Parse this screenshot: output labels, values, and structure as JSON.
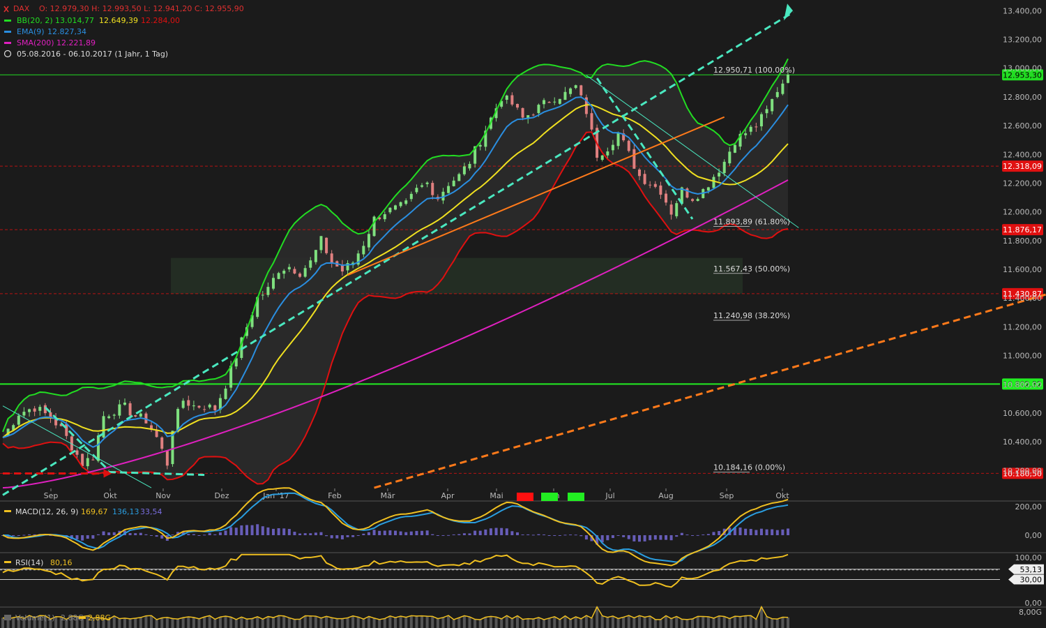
{
  "header": {
    "symbol": "DAX",
    "ohlc": "O: 12.979,30  H: 12.993,50  L: 12.941,20  C: 12.955,90",
    "bb_label": "BB(20, 2)",
    "bb_upper": "13.014,77",
    "bb_mid": "12.649,39",
    "bb_lower": "12.284,00",
    "ema_label": "EMA(9)",
    "ema_value": "12.827,34",
    "sma_label": "SMA(200)",
    "sma_value": "12.221,89",
    "range": "05.08.2016 - 06.10.2017  (1 Jahr, 1 Tag)"
  },
  "colors": {
    "background": "#1b1b1b",
    "bb_band": "#22dd22",
    "bb_mid": "#f0e020",
    "bb_lower": "#e01010",
    "ema": "#2a8ee0",
    "sma": "#e020c0",
    "trend_cyan": "#4ae8c0",
    "trend_orange": "#ff7a1a",
    "support_green": "#22ee22",
    "level_red": "#e01010",
    "macd": "#f0c020",
    "signal": "#2a9ee0",
    "hist": "#7a6ee0"
  },
  "chart_data": [
    {
      "type": "line",
      "title": "DAX",
      "x_ticks": [
        "Sep",
        "Okt",
        "Nov",
        "Dez",
        "Jan '17",
        "Feb",
        "Mär",
        "Apr",
        "Mai",
        "Jun",
        "Jul",
        "Aug",
        "Sep",
        "Okt"
      ],
      "y_ticks": [
        "13.400,00",
        "13.200,00",
        "13.000,00",
        "12.800,00",
        "12.600,00",
        "12.400,00",
        "12.200,00",
        "12.000,00",
        "11.800,00",
        "11.600,00",
        "11.400,00",
        "11.200,00",
        "11.000,00",
        "10.800,00",
        "10.600,00",
        "10.400,00",
        "10.200,00"
      ],
      "ylim": [
        10100,
        13450
      ],
      "price_series": [
        [
          0,
          10430
        ],
        [
          3,
          10600
        ],
        [
          6,
          10640
        ],
        [
          9,
          10570
        ],
        [
          11,
          10490
        ],
        [
          13,
          10370
        ],
        [
          15,
          10250
        ],
        [
          17,
          10300
        ],
        [
          19,
          10580
        ],
        [
          21,
          10620
        ],
        [
          23,
          10640
        ],
        [
          25,
          10580
        ],
        [
          27,
          10550
        ],
        [
          29,
          10430
        ],
        [
          31,
          10250
        ],
        [
          32,
          10500
        ],
        [
          34,
          10690
        ],
        [
          36,
          10650
        ],
        [
          38,
          10650
        ],
        [
          40,
          10630
        ],
        [
          42,
          10800
        ],
        [
          44,
          11000
        ],
        [
          46,
          11200
        ],
        [
          48,
          11400
        ],
        [
          50,
          11460
        ],
        [
          52,
          11600
        ],
        [
          54,
          11620
        ],
        [
          56,
          11580
        ],
        [
          58,
          11650
        ],
        [
          60,
          11800
        ],
        [
          62,
          11650
        ],
        [
          64,
          11590
        ],
        [
          66,
          11650
        ],
        [
          68,
          11780
        ],
        [
          70,
          11950
        ],
        [
          72,
          12000
        ],
        [
          74,
          12020
        ],
        [
          76,
          12050
        ],
        [
          78,
          12150
        ],
        [
          80,
          12200
        ],
        [
          82,
          12100
        ],
        [
          84,
          12200
        ],
        [
          86,
          12250
        ],
        [
          88,
          12350
        ],
        [
          90,
          12500
        ],
        [
          92,
          12650
        ],
        [
          94,
          12800
        ],
        [
          96,
          12750
        ],
        [
          98,
          12650
        ],
        [
          100,
          12700
        ],
        [
          102,
          12750
        ],
        [
          104,
          12800
        ],
        [
          106,
          12820
        ],
        [
          108,
          12870
        ],
        [
          110,
          12700
        ],
        [
          112,
          12400
        ],
        [
          114,
          12450
        ],
        [
          116,
          12550
        ],
        [
          118,
          12400
        ],
        [
          120,
          12250
        ],
        [
          122,
          12200
        ],
        [
          124,
          12150
        ],
        [
          126,
          12000
        ],
        [
          128,
          12150
        ],
        [
          130,
          12100
        ],
        [
          132,
          12150
        ],
        [
          134,
          12250
        ],
        [
          136,
          12350
        ],
        [
          138,
          12500
        ],
        [
          140,
          12550
        ],
        [
          142,
          12600
        ],
        [
          144,
          12700
        ],
        [
          146,
          12850
        ],
        [
          148,
          12955
        ]
      ],
      "levels": [
        {
          "label": "12.953,30",
          "value": 12953.3,
          "color": "#22dd22"
        },
        {
          "label": "12.318,09",
          "value": 12318.09,
          "color": "#e01010"
        },
        {
          "label": "11.876,17",
          "value": 11876.17,
          "color": "#e01010"
        },
        {
          "label": "11.430,87",
          "value": 11430.87,
          "color": "#e01010"
        },
        {
          "label": "10.802,32",
          "value": 10802.32,
          "color": "#22ee22"
        },
        {
          "label": "10.180,50",
          "value": 10180.5,
          "color": "#e01010"
        }
      ],
      "fib": [
        {
          "label": "12.950,71 (100.00%)",
          "value": 12950.71
        },
        {
          "label": "11.893,89 (61.80%)",
          "value": 11893.89
        },
        {
          "label": "11.567,43 (50.00%)",
          "value": 11567.43
        },
        {
          "label": "11.240,98 (38.20%)",
          "value": 11240.98
        },
        {
          "label": "10.184,16 (0.00%)",
          "value": 10184.16
        }
      ]
    },
    {
      "type": "line",
      "title": "MACD(12, 26, 9)",
      "legend_values": [
        "169,67",
        "136,13",
        "33,54"
      ],
      "y_ticks": [
        "200,00",
        "0,00"
      ]
    },
    {
      "type": "line",
      "title": "RSI(14)",
      "legend_value": "80,16",
      "y_ticks": [
        "100,00",
        "0,00"
      ],
      "levels": [
        "53,13",
        "30,00"
      ]
    },
    {
      "type": "bar",
      "title": "Volume(1)",
      "legend_values": [
        "2,88G",
        "2,88G"
      ],
      "y_ticks": [
        "8,00G"
      ]
    }
  ]
}
